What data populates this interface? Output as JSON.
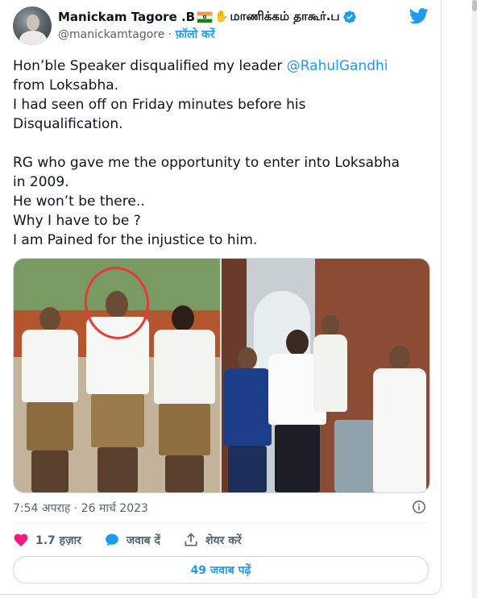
{
  "author": {
    "display_name": "Manickam Tagore .B",
    "display_name_tamil": "மாணிக்கம் தாகூர்.ப",
    "handle": "@manickamtagore",
    "separator": " · ",
    "follow_label": "फ़ॉलो करें",
    "hand_emoji": "✋"
  },
  "tweet": {
    "lines": [
      {
        "before": "Hon’ble Speaker disqualified my leader ",
        "mention": "@RahulGandhi",
        "after": ""
      },
      {
        "before": "from Loksabha.",
        "mention": "",
        "after": ""
      },
      {
        "before": "I had seen off on Friday minutes before his",
        "mention": "",
        "after": ""
      },
      {
        "before": "Disqualification.",
        "mention": "",
        "after": ""
      },
      {
        "before": "",
        "mention": "",
        "after": ""
      },
      {
        "before": "RG who gave me the opportunity to enter into Loksabha",
        "mention": "",
        "after": ""
      },
      {
        "before": "in 2009.",
        "mention": "",
        "after": ""
      },
      {
        "before": "He won’t be there..",
        "mention": "",
        "after": ""
      },
      {
        "before": "Why I have to be ?",
        "mention": "",
        "after": ""
      },
      {
        "before": "I am Pained for the injustice to him.",
        "mention": "",
        "after": ""
      }
    ]
  },
  "timestamp": {
    "time": "7:54 अपराह",
    "separator": " · ",
    "date": "26 मार्च 2023"
  },
  "actions": {
    "like_count": "1.7 हज़ार",
    "reply_label": "जवाब दें",
    "share_label": "शेयर करें"
  },
  "read_replies_label": "49 जवाब पढ़ें",
  "colors": {
    "accent": "#1d9bf0",
    "like": "#f91880",
    "text": "#0f1419",
    "secondary": "#536471",
    "circle_mark": "#e63a3a"
  },
  "icons": {
    "verified": "verified-badge-icon",
    "twitter": "twitter-bird-icon",
    "info": "info-icon",
    "like": "heart-icon",
    "reply": "reply-bubble-icon",
    "share": "share-upload-icon"
  }
}
